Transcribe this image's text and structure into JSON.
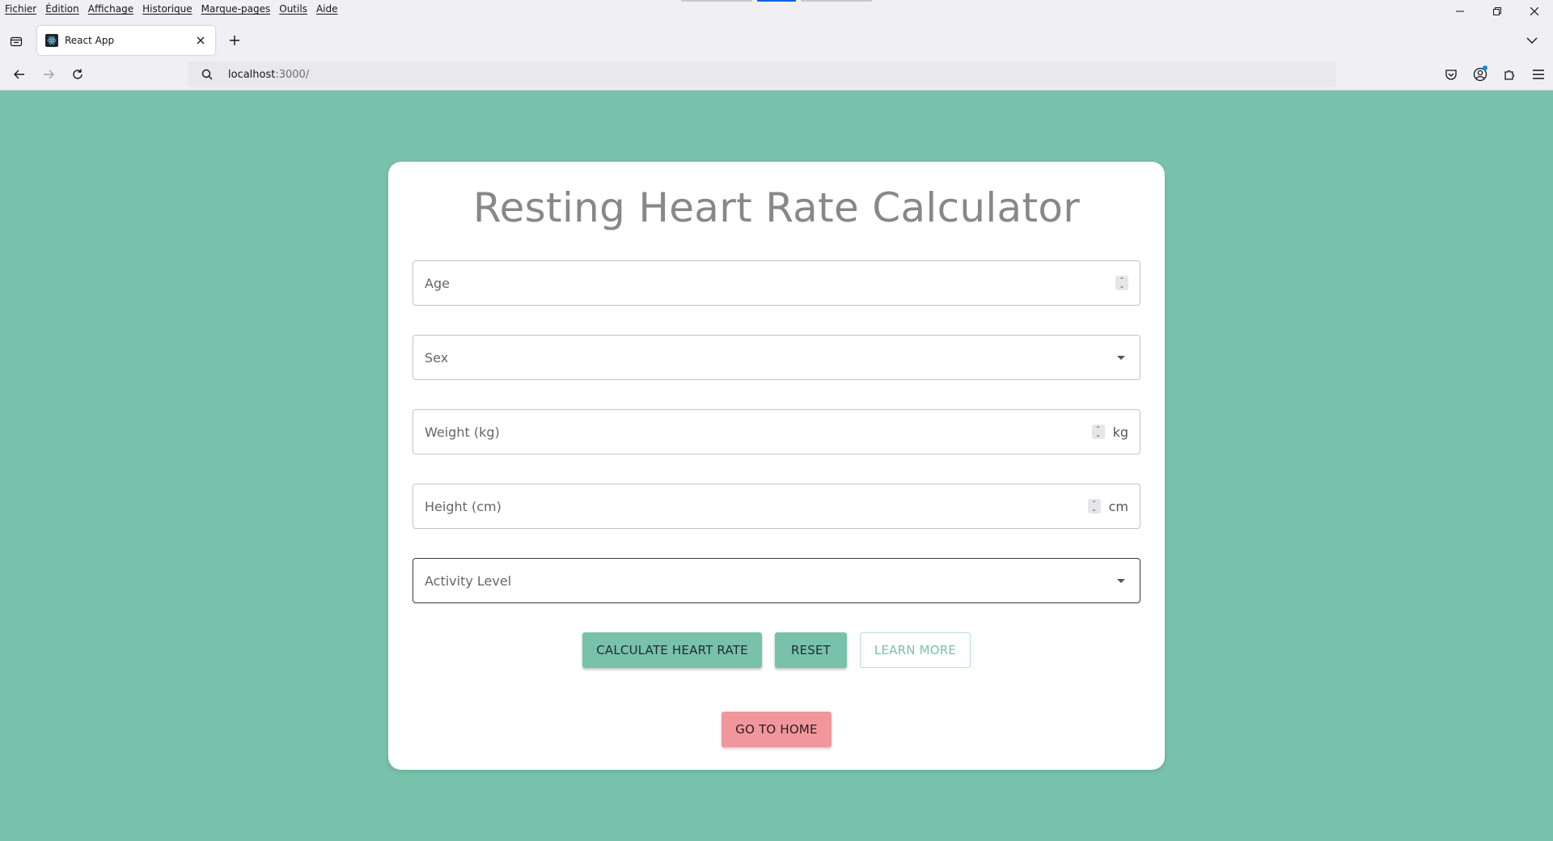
{
  "browser": {
    "menu": [
      "Fichier",
      "Édition",
      "Affichage",
      "Historique",
      "Marque-pages",
      "Outils",
      "Aide"
    ],
    "tab_title": "React App",
    "url_host": "localhost",
    "url_port": ":3000/"
  },
  "page": {
    "title": "Resting Heart Rate Calculator",
    "fields": {
      "age": "Age",
      "sex": "Sex",
      "weight": "Weight (kg)",
      "weight_unit": "kg",
      "height": "Height (cm)",
      "height_unit": "cm",
      "activity": "Activity Level"
    },
    "buttons": {
      "calculate": "CALCULATE HEART RATE",
      "reset": "RESET",
      "learn_more": "LEARN MORE",
      "home": "GO TO HOME"
    }
  },
  "colors": {
    "background": "#78c1ab",
    "accent": "#78c1ab",
    "home_button": "#f1979c",
    "title_text": "#888888"
  },
  "icons": [
    "tab-list-icon",
    "react-favicon-icon",
    "close-icon",
    "plus-icon",
    "chevron-down-icon",
    "back-arrow-icon",
    "forward-arrow-icon",
    "reload-icon",
    "search-icon",
    "pocket-icon",
    "account-icon",
    "extensions-icon",
    "hamburger-menu-icon"
  ]
}
